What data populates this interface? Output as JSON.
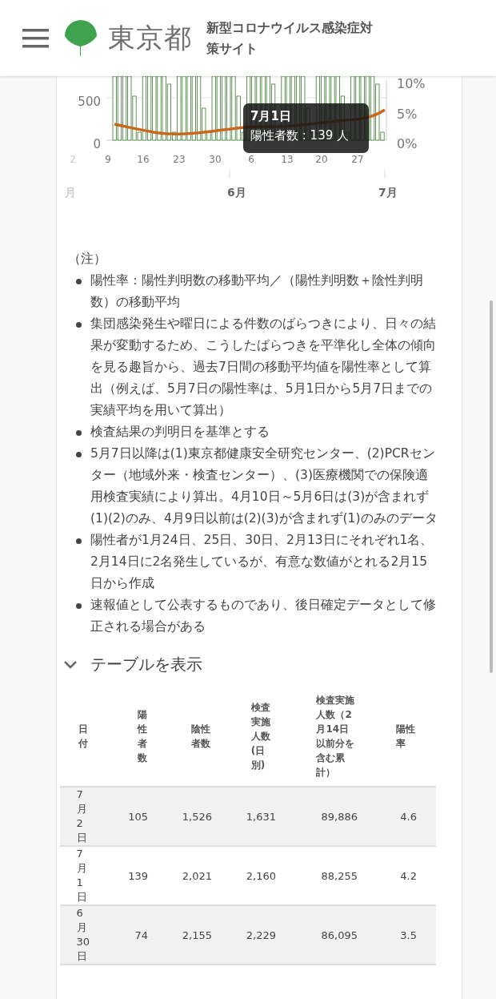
{
  "header": {
    "logo_text": "東京都",
    "site_title": "新型コロナウイルス感染症対策サイト"
  },
  "chart": {
    "left_ticks": [
      "500",
      "0"
    ],
    "right_ticks": [
      "10%",
      "5%",
      "0%"
    ],
    "day_labels": [
      "2",
      "9",
      "16",
      "23",
      "30",
      "6",
      "13",
      "20",
      "27"
    ],
    "month_labels": [
      "月",
      "6月",
      "7月"
    ],
    "tooltip": {
      "title": "7月1日",
      "body": "陽性者数 : 139 人"
    }
  },
  "notes": {
    "heading": "（注）",
    "items": [
      "陽性率：陽性判明数の移動平均／（陽性判明数＋陰性判明数）の移動平均",
      "集団感染発生や曜日による件数のばらつきにより、日々の結果が変動するため、こうしたばらつきを平準化し全体の傾向を見る趣旨から、過去7日間の移動平均値を陽性率として算出（例えば、5月7日の陽性率は、5月1日から5月7日までの実績平均を用いて算出）",
      "検査結果の判明日を基準とする",
      "5月7日以降は(1)東京都健康安全研究センター、(2)PCRセンター（地域外来・検査センター）、(3)医療機関での保険適用検査実績により算出。4月10日～5月6日は(3)が含まれず(1)(2)のみ、4月9日以前は(2)(3)が含まれず(1)のみのデータ",
      "陽性者が1月24日、25日、30日、2月13日にそれぞれ1名、2月14日に2名発生しているが、有意な数値がとれる2月15日から作成",
      "速報値として公表するものであり、後日確定データとして修正される場合がある"
    ]
  },
  "table_toggle": {
    "label": "テーブルを表示",
    "expanded": true
  },
  "table": {
    "columns": [
      "日付",
      "陽性者数",
      "陰性者数",
      "検査実施人数(日別)",
      "検査実施人数（2月14日以前分を含む累計）",
      "陽性率"
    ],
    "rows": [
      [
        "7月2日",
        "105",
        "1,526",
        "1,631",
        "89,886",
        "4.6"
      ],
      [
        "7月1日",
        "139",
        "2,021",
        "2,160",
        "88,255",
        "4.2"
      ],
      [
        "6月30日",
        "74",
        "2,155",
        "2,229",
        "86,095",
        "3.5"
      ]
    ]
  }
}
